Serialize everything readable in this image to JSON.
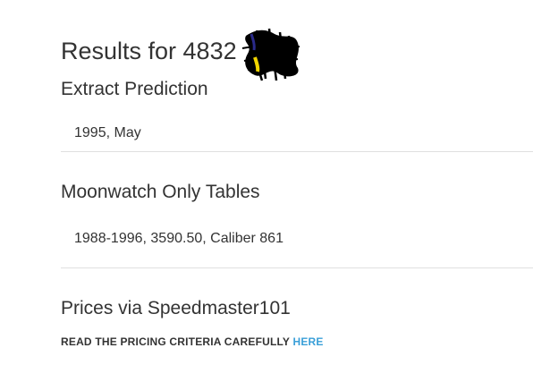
{
  "header": {
    "results_title": "Results for 4832"
  },
  "extract_prediction": {
    "title": "Extract Prediction",
    "value": "1995, May"
  },
  "moonwatch_tables": {
    "title": "Moonwatch Only Tables",
    "value": "1988-1996, 3590.50, Caliber 861"
  },
  "prices": {
    "title": "Prices via Speedmaster101",
    "criteria_text": "READ THE PRICING CRITERIA CAREFULLY",
    "link_text": "HERE"
  },
  "colors": {
    "link": "#3a9fd8",
    "text": "#333333",
    "divider": "#e0e0e0"
  }
}
